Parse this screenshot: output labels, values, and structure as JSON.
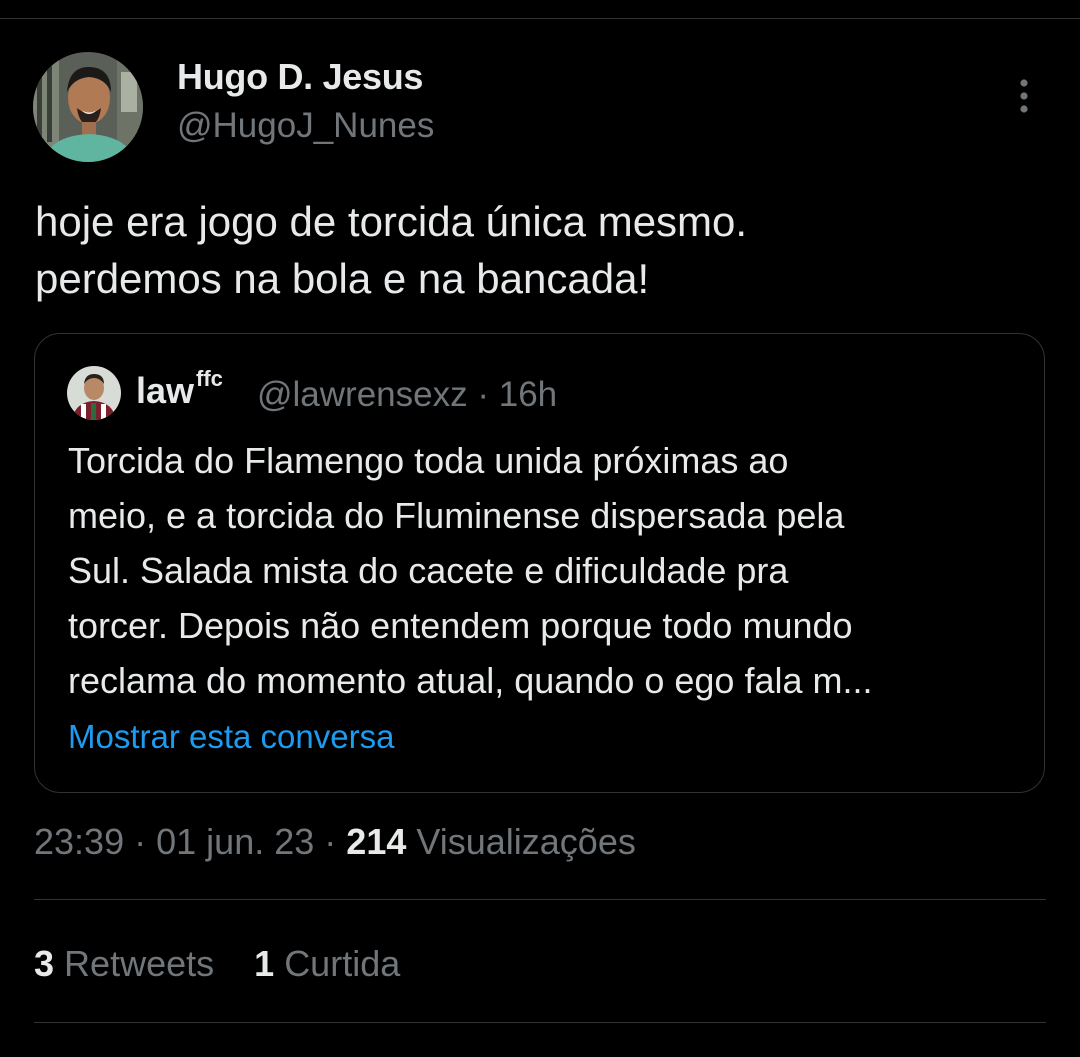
{
  "author": {
    "display_name": "Hugo D. Jesus",
    "handle": "@HugoJ_Nunes"
  },
  "tweet": {
    "text": "hoje era jogo de torcida única mesmo.\nperdemos na bola e na bancada!"
  },
  "quoted_tweet": {
    "name": "law",
    "name_superscript": "ffc",
    "handle": "@lawrensexz",
    "separator": "·",
    "time": "16h",
    "text": "Torcida do Flamengo toda unida próximas ao\nmeio, e a torcida do Fluminense dispersada pela\nSul. Salada mista do cacete e dificuldade pra\ntorcer. Depois não entendem porque todo mundo\nreclama do momento atual, quando o ego fala m...",
    "show_thread_label": "Mostrar esta conversa"
  },
  "meta": {
    "time": "23:39",
    "separator": "·",
    "date": "01 jun. 23",
    "views_count": "214",
    "views_label": "Visualizações"
  },
  "stats": {
    "retweets_count": "3",
    "retweets_label": "Retweets",
    "likes_count": "1",
    "likes_label": "Curtida"
  },
  "icons": {
    "more": "more-vertical-icon"
  },
  "colors": {
    "background": "#000000",
    "text_primary": "#e7e9ea",
    "text_secondary": "#71767b",
    "link": "#1d9bf0",
    "border": "#2f3336"
  }
}
